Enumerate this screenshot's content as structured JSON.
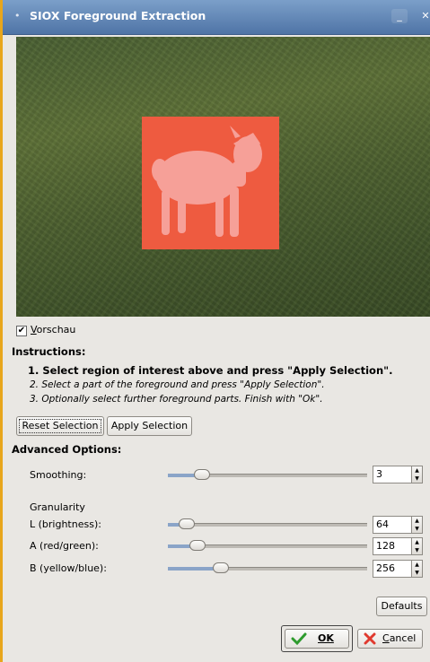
{
  "window": {
    "title": "SIOX Foreground Extraction",
    "menu_glyph": "•",
    "minimize_glyph": "_",
    "close_glyph": "✕"
  },
  "preview": {
    "checkbox_label_prefix": "V",
    "checkbox_label_rest": "orschau",
    "checked": true
  },
  "instructions": {
    "heading": "Instructions:",
    "step1": "1. Select region of interest above and press \"Apply Selection\".",
    "step2": "2. Select a part of the foreground and press \"Apply Selection\".",
    "step3": "3. Optionally select further foreground parts. Finish with \"Ok\"."
  },
  "buttons": {
    "reset": "Reset Selection",
    "apply": "Apply Selection",
    "defaults": "Defaults",
    "ok": "OK",
    "cancel_prefix": "C",
    "cancel_rest": "ancel"
  },
  "advanced": {
    "heading": "Advanced Options:",
    "smoothing_label": "Smoothing:",
    "smoothing_value": "3",
    "granularity_label": "Granularity",
    "l_label": "L (brightness):",
    "l_value": "64",
    "a_label": "A (red/green):",
    "a_value": "128",
    "b_label": "B (yellow/blue):",
    "b_value": "256"
  },
  "colors": {
    "title_bar": "#5a80b3",
    "window_border": "#e8a61c",
    "selection_overlay": "#ee5b40",
    "dialog_bg": "#e9e7e3"
  },
  "icons": {
    "ok": "green-check-icon",
    "cancel": "red-x-icon",
    "spin_up": "▲",
    "spin_down": "▼"
  }
}
